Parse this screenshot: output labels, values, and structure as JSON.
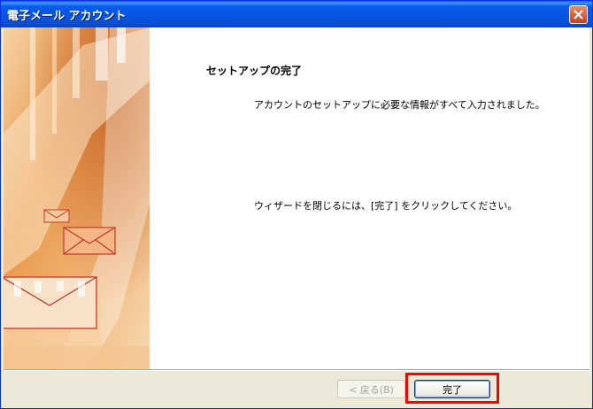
{
  "window": {
    "title": "電子メール アカウント"
  },
  "page": {
    "heading": "セットアップの完了",
    "message1": "アカウントのセットアップに必要な情報がすべて入力されました。",
    "message2": "ウィザードを閉じるには、[完了] をクリックしてください。"
  },
  "buttons": {
    "back_label": "< 戻る(B)",
    "finish_label": "完了"
  },
  "colors": {
    "titlebar": "#0a5fd8",
    "highlight": "#ff0000",
    "dialog_bg": "#ece9d8"
  }
}
